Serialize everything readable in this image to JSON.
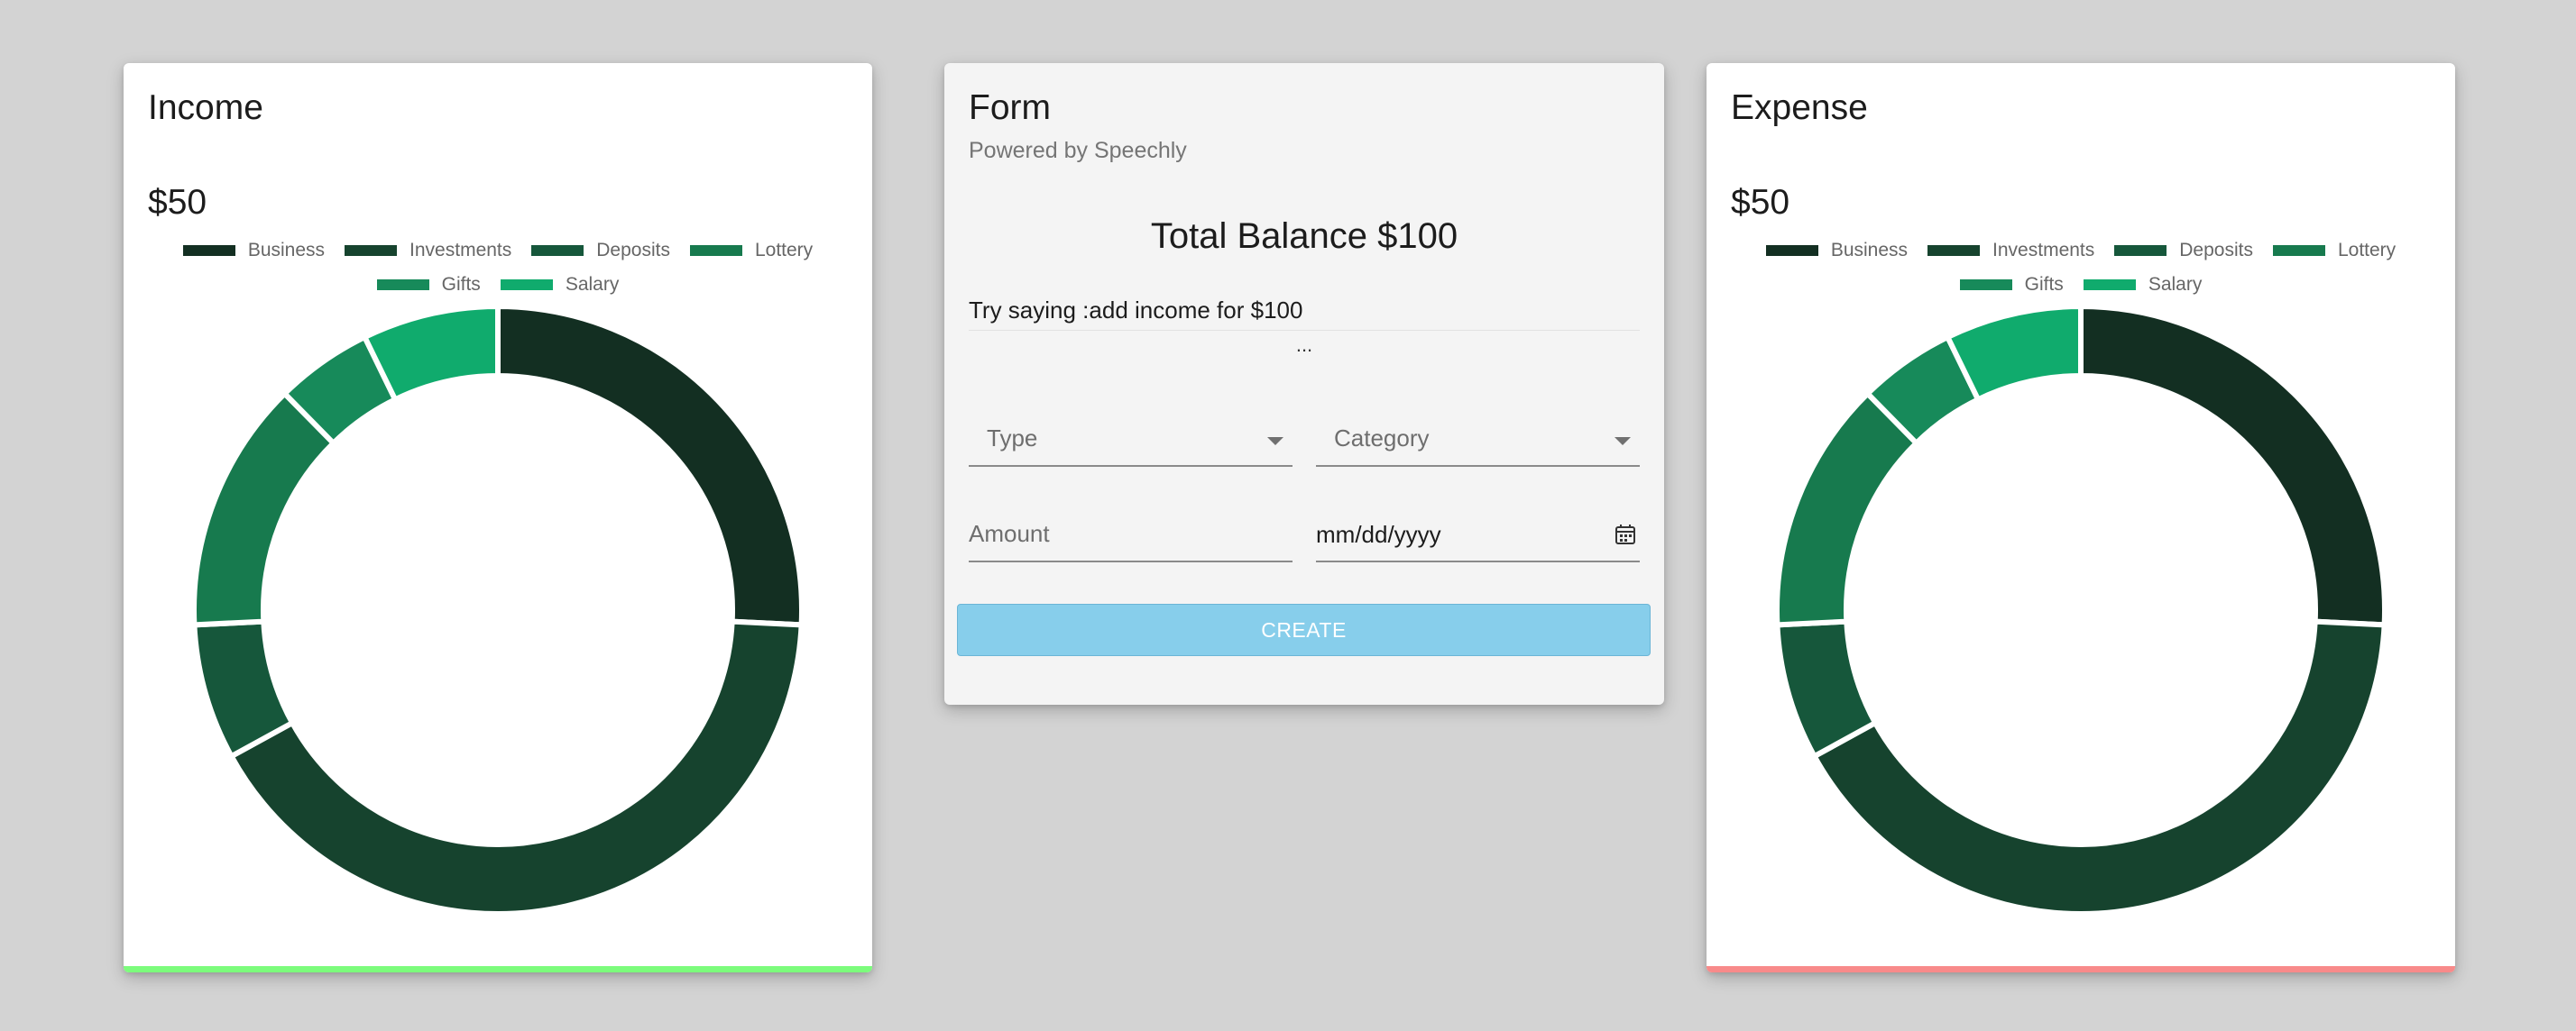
{
  "income": {
    "title": "Income",
    "amount": "$50",
    "accent": "#7cfc7c",
    "legend": [
      {
        "label": "Business",
        "color": "#132f22"
      },
      {
        "label": "Investments",
        "color": "#16432e"
      },
      {
        "label": "Deposits",
        "color": "#16573b"
      },
      {
        "label": "Lottery",
        "color": "#177a4e"
      },
      {
        "label": "Gifts",
        "color": "#178a5a"
      },
      {
        "label": "Salary",
        "color": "#10ab6d"
      }
    ]
  },
  "expense": {
    "title": "Expense",
    "amount": "$50",
    "accent": "#f88a8a",
    "legend": [
      {
        "label": "Business",
        "color": "#132f22"
      },
      {
        "label": "Investments",
        "color": "#16432e"
      },
      {
        "label": "Deposits",
        "color": "#16573b"
      },
      {
        "label": "Lottery",
        "color": "#177a4e"
      },
      {
        "label": "Gifts",
        "color": "#178a5a"
      },
      {
        "label": "Salary",
        "color": "#10ab6d"
      }
    ]
  },
  "chart_data": [
    {
      "type": "pie",
      "title": "Income",
      "categories": [
        "Business",
        "Investments",
        "Deposits",
        "Lottery",
        "Gifts",
        "Salary"
      ],
      "values": [
        25,
        40,
        7,
        13,
        5,
        7
      ]
    },
    {
      "type": "pie",
      "title": "Expense",
      "categories": [
        "Business",
        "Investments",
        "Deposits",
        "Lottery",
        "Gifts",
        "Salary"
      ],
      "values": [
        25,
        40,
        7,
        13,
        5,
        7
      ]
    }
  ],
  "form": {
    "title": "Form",
    "subtitle": "Powered by Speechly",
    "balance": "Total Balance $100",
    "hint": "Try saying :add income for $100",
    "dots": "...",
    "type_label": "Type",
    "category_label": "Category",
    "amount_label": "Amount",
    "date_value": "mm/dd/yyyy",
    "create_label": "CREATE",
    "button_color": "#87ceeb"
  }
}
